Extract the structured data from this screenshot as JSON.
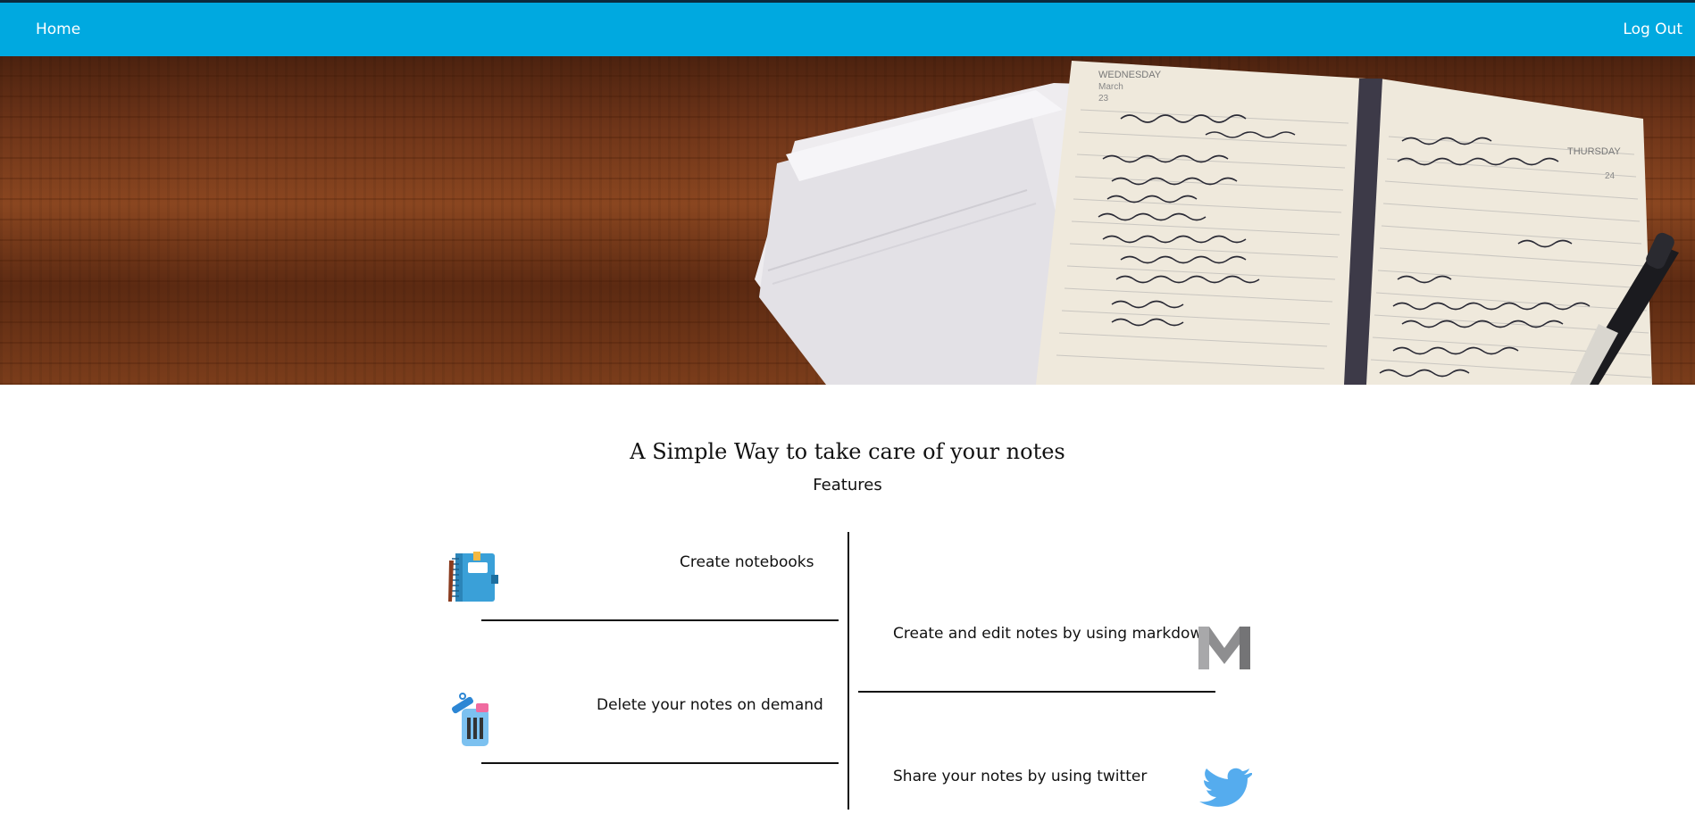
{
  "nav": {
    "home_label": "Home",
    "logout_label": "Log Out",
    "bg_color": "#00a9e0"
  },
  "hero": {
    "image": "wooden-desk-with-open-notebook-and-pen",
    "notebook_date_left": "WEDNESDAY",
    "notebook_month_left": "March",
    "notebook_day_left": "23",
    "notebook_date_right": "THURSDAY",
    "notebook_day_right": "24"
  },
  "main": {
    "title": "A Simple Way to take care of your notes",
    "subtitle": "Features"
  },
  "features": {
    "left": [
      {
        "label": "Create notebooks",
        "icon": "notebook-icon"
      },
      {
        "label": "Delete your notes on demand",
        "icon": "trash-icon"
      }
    ],
    "right": [
      {
        "label": "Create and edit notes by using markdown",
        "icon": "markdown-icon"
      },
      {
        "label": "Share your notes by using twitter",
        "icon": "twitter-icon"
      }
    ]
  }
}
